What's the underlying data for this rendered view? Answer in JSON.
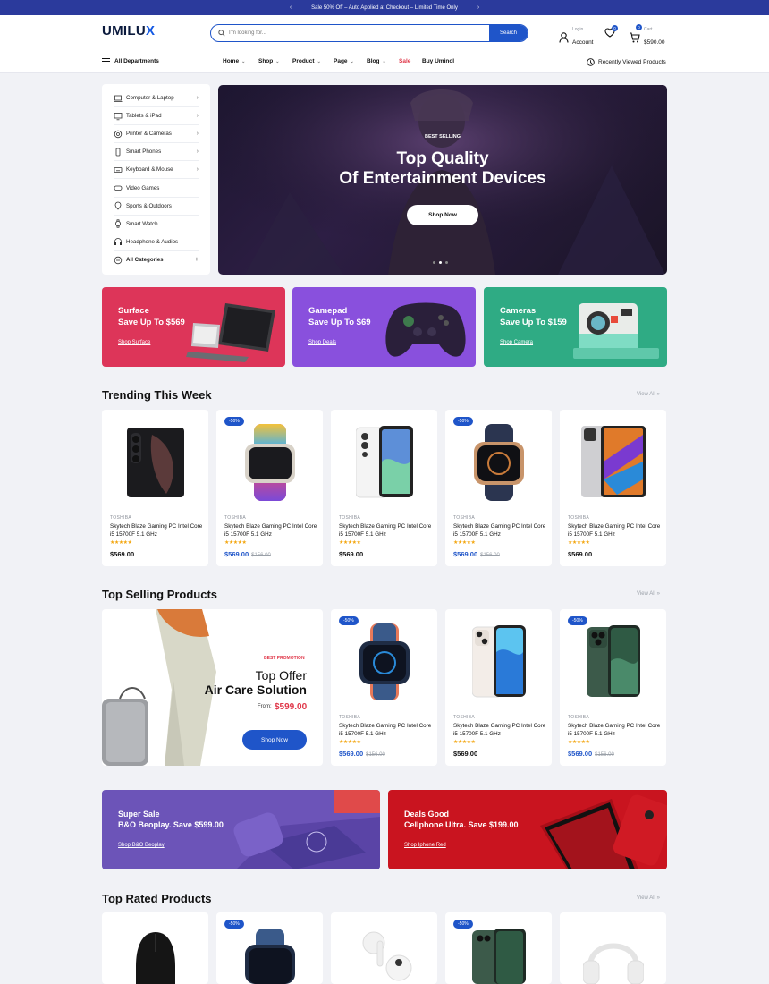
{
  "topbar": {
    "message": "Sale 50% Off – Auto Applied at Checkout – Limited Time Only",
    "prev": "‹",
    "next": "›"
  },
  "header": {
    "logo_main": "UMILU",
    "logo_accent": "X",
    "search_placeholder": "I'm looking for...",
    "search_button": "Search",
    "login_small": "Login",
    "login_label": "Account",
    "wishlist_count": "0",
    "cart_count": "0",
    "cart_small": "Cart",
    "cart_total": "$590.00"
  },
  "nav": {
    "all_departments": "All Departments",
    "items": [
      "Home",
      "Shop",
      "Product",
      "Page",
      "Blog",
      "Sale",
      "Buy Uminol"
    ],
    "recently_viewed": "Recently Viewed Products"
  },
  "sidebar": {
    "items": [
      "Computer & Laptop",
      "Tablets & iPad",
      "Printer & Cameras",
      "Smart Phones",
      "Keyboard & Mouse",
      "Video Games",
      "Sports & Outdoors",
      "Smart Watch",
      "Headphone & Audios",
      "All Categories"
    ]
  },
  "hero": {
    "kicker": "BEST SELLING",
    "title_line1": "Top Quality",
    "title_line2": "Of Entertainment Devices",
    "button": "Shop Now"
  },
  "promos": [
    {
      "line1": "Surface",
      "line2": "Save Up To $569",
      "link": "Shop Surface",
      "color": "#dd3559"
    },
    {
      "line1": "Gamepad",
      "line2": "Save Up To $69",
      "link": "Shop Deals",
      "color": "#8950dd"
    },
    {
      "line1": "Cameras",
      "line2": "Save Up To $159",
      "link": "Shop Camera",
      "color": "#2fab84"
    }
  ],
  "trending": {
    "title": "Trending This Week",
    "view_all": "View All »",
    "products": [
      {
        "brand": "TOSHIBA",
        "name": "Skytech Blaze Gaming PC Intel Core i5 15700F 5.1 GHz",
        "stars": "★★★★★",
        "price": "$569.00",
        "old": "",
        "badge": ""
      },
      {
        "brand": "TOSHIBA",
        "name": "Skytech Blaze Gaming PC Intel Core i5 15700F 5.1 GHz",
        "stars": "★★★★★",
        "price": "$569.00",
        "old": "$156.00",
        "badge": "-50%"
      },
      {
        "brand": "TOSHIBA",
        "name": "Skytech Blaze Gaming PC Intel Core i5 15700F 5.1 GHz",
        "stars": "★★★★★",
        "price": "$569.00",
        "old": "",
        "badge": ""
      },
      {
        "brand": "TOSHIBA",
        "name": "Skytech Blaze Gaming PC Intel Core i5 15700F 5.1 GHz",
        "stars": "★★★★★",
        "price": "$569.00",
        "old": "$156.00",
        "badge": "-50%"
      },
      {
        "brand": "TOSHIBA",
        "name": "Skytech Blaze Gaming PC Intel Core i5 15700F 5.1 GHz",
        "stars": "★★★★★",
        "price": "$569.00",
        "old": "",
        "badge": ""
      }
    ]
  },
  "top_selling": {
    "title": "Top Selling Products",
    "view_all": "View All »",
    "promo": {
      "kicker": "BEST PROMOTION",
      "line1": "Top Offer",
      "line2": "Air Care Solution",
      "from_label": "From:",
      "from_price": "$599.00",
      "button": "Shop Now"
    },
    "products": [
      {
        "brand": "TOSHIBA",
        "name": "Skytech Blaze Gaming PC Intel Core i5 15700F 5.1 GHz",
        "stars": "★★★★★",
        "price": "$569.00",
        "old": "$156.00",
        "badge": "-50%"
      },
      {
        "brand": "TOSHIBA",
        "name": "Skytech Blaze Gaming PC Intel Core i5 15700F 5.1 GHz",
        "stars": "★★★★★",
        "price": "$569.00",
        "old": "",
        "badge": ""
      },
      {
        "brand": "TOSHIBA",
        "name": "Skytech Blaze Gaming PC Intel Core i5 15700F 5.1 GHz",
        "stars": "★★★★★",
        "price": "$569.00",
        "old": "$156.00",
        "badge": "-50%"
      }
    ]
  },
  "banners": [
    {
      "line1": "Super Sale",
      "line2": "B&O Beoplay. Save $599.00",
      "link": "Shop B&O Beoplay",
      "color": "#6c54b8"
    },
    {
      "line1": "Deals Good",
      "line2": "Cellphone Ultra. Save $199.00",
      "link": "Shop Iphone Red",
      "color": "#c9141f"
    }
  ],
  "top_rated": {
    "title": "Top Rated Products",
    "view_all": "View All »",
    "badges": [
      "",
      "-50%",
      "",
      "-50%",
      ""
    ]
  }
}
